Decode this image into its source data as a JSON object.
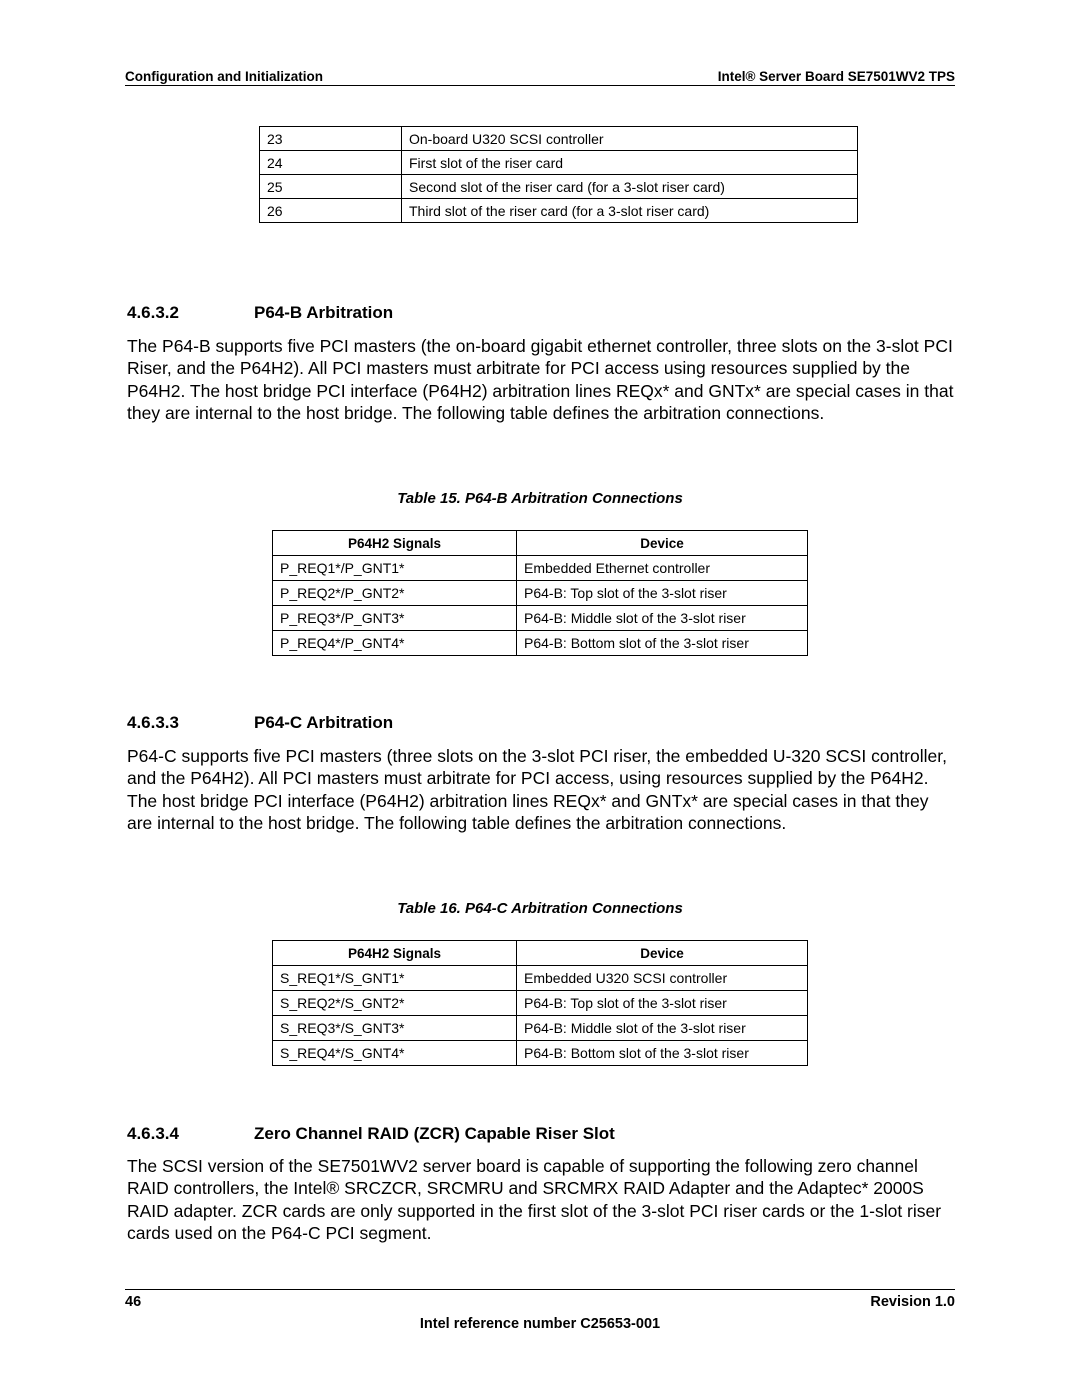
{
  "header": {
    "left": "Configuration and Initialization",
    "right": "Intel® Server Board SE7501WV2 TPS"
  },
  "top_table": {
    "rows": [
      {
        "id": "23",
        "desc": "On-board U320 SCSI controller"
      },
      {
        "id": "24",
        "desc": "First slot of the riser card"
      },
      {
        "id": "25",
        "desc": "Second slot of the riser card (for a 3-slot riser card)"
      },
      {
        "id": "26",
        "desc": "Third slot of the riser card (for a 3-slot riser card)"
      }
    ]
  },
  "sections": [
    {
      "number": "4.6.3.2",
      "title": "P64-B Arbitration",
      "body": "The P64-B supports five PCI masters (the on-board gigabit ethernet controller, three slots on the 3-slot PCI Riser, and the P64H2). All PCI masters must arbitrate for PCI access using resources supplied by the P64H2. The host bridge PCI interface (P64H2) arbitration lines REQx* and GNTx* are special cases in that they are internal to the host bridge. The following table defines the arbitration connections.",
      "table": {
        "caption": "Table 15. P64-B Arbitration Connections",
        "headers": [
          "P64H2 Signals",
          "Device"
        ],
        "rows": [
          [
            "P_REQ1*/P_GNT1*",
            "Embedded Ethernet controller"
          ],
          [
            "P_REQ2*/P_GNT2*",
            "P64-B: Top slot of the 3-slot riser"
          ],
          [
            "P_REQ3*/P_GNT3*",
            "P64-B: Middle slot of the 3-slot riser"
          ],
          [
            "P_REQ4*/P_GNT4*",
            "P64-B: Bottom slot of the 3-slot riser"
          ]
        ]
      }
    },
    {
      "number": "4.6.3.3",
      "title": "P64-C Arbitration",
      "body": "P64-C supports five PCI masters (three slots on the 3-slot PCI riser, the embedded U-320 SCSI controller, and the P64H2). All PCI masters must arbitrate for PCI access, using resources supplied by the P64H2. The host bridge PCI interface (P64H2) arbitration lines REQx* and GNTx* are special cases in that they are internal to the host bridge. The following table defines the arbitration connections.",
      "table": {
        "caption": "Table 16. P64-C Arbitration Connections",
        "headers": [
          "P64H2 Signals",
          "Device"
        ],
        "rows": [
          [
            "S_REQ1*/S_GNT1*",
            "Embedded U320 SCSI controller"
          ],
          [
            "S_REQ2*/S_GNT2*",
            "P64-B: Top slot of the 3-slot riser"
          ],
          [
            "S_REQ3*/S_GNT3*",
            "P64-B: Middle slot of the 3-slot riser"
          ],
          [
            "S_REQ4*/S_GNT4*",
            "P64-B: Bottom slot of the 3-slot riser"
          ]
        ]
      }
    },
    {
      "number": "4.6.3.4",
      "title": "Zero Channel RAID (ZCR) Capable Riser Slot",
      "body": "The SCSI version of the SE7501WV2 server board is capable of supporting the following zero channel RAID controllers, the Intel® SRCZCR, SRCMRU and SRCMRX RAID Adapter and the Adaptec* 2000S RAID adapter. ZCR cards are only supported in the first slot of  the 3-slot PCI riser cards or the 1-slot riser cards used on the P64-C PCI segment."
    }
  ],
  "footer": {
    "page_number": "46",
    "revision": "Revision 1.0",
    "reference": "Intel reference number C25653-001"
  }
}
